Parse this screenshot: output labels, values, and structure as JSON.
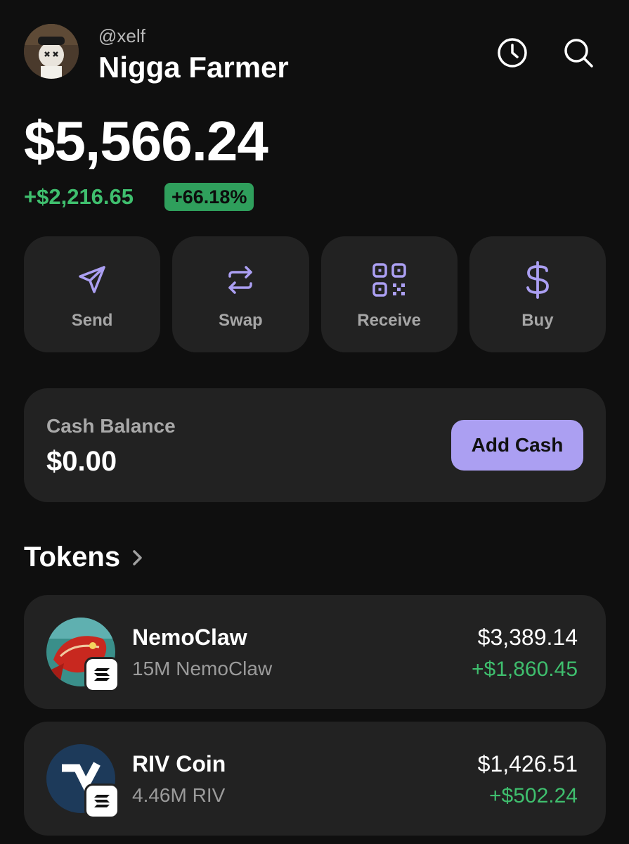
{
  "profile": {
    "handle": "@xelf",
    "username": "Nigga Farmer",
    "avatar_icon": "profile-avatar"
  },
  "header": {
    "history_icon": "clock-icon",
    "search_icon": "search-icon"
  },
  "portfolio": {
    "balance": "$5,566.24",
    "change_amount": "+$2,216.65",
    "change_percent": "+66.18%"
  },
  "actions": [
    {
      "label": "Send",
      "icon": "send-icon"
    },
    {
      "label": "Swap",
      "icon": "swap-icon"
    },
    {
      "label": "Receive",
      "icon": "qr-code-icon"
    },
    {
      "label": "Buy",
      "icon": "dollar-icon"
    }
  ],
  "cash": {
    "label": "Cash Balance",
    "value": "$0.00",
    "button_label": "Add Cash"
  },
  "tokens": {
    "title": "Tokens",
    "items": [
      {
        "name": "NemoClaw",
        "amount": "15M NemoClaw",
        "value": "$3,389.14",
        "change": "+$1,860.45",
        "chain_icon": "solana-icon"
      },
      {
        "name": "RIV Coin",
        "amount": "4.46M RIV",
        "value": "$1,426.51",
        "change": "+$502.24",
        "chain_icon": "solana-icon"
      }
    ]
  },
  "colors": {
    "background": "#0f0f0f",
    "card": "#222222",
    "accent": "#ab9ff2",
    "positive": "#3fbf6e"
  }
}
